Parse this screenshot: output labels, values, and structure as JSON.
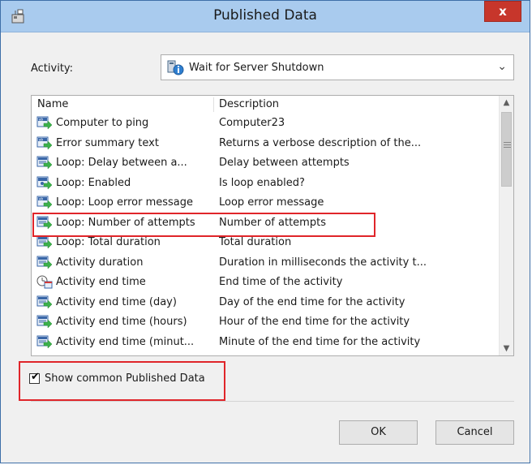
{
  "window": {
    "title": "Published Data",
    "close_label": "x"
  },
  "activity": {
    "label": "Activity:",
    "selected": "Wait for Server Shutdown"
  },
  "list": {
    "columns": {
      "name": "Name",
      "description": "Description"
    },
    "rows": [
      {
        "name": "Computer to ping",
        "description": "Computer23",
        "icon": "text-data-icon"
      },
      {
        "name": "Error summary text",
        "description": "Returns a verbose description of the...",
        "icon": "text-data-icon"
      },
      {
        "name": "Loop: Delay between a...",
        "description": "Delay between attempts",
        "icon": "number-data-icon"
      },
      {
        "name": "Loop: Enabled",
        "description": "Is loop enabled?",
        "icon": "boolean-data-icon"
      },
      {
        "name": "Loop: Loop error message",
        "description": "Loop error message",
        "icon": "text-data-icon"
      },
      {
        "name": "Loop: Number of attempts",
        "description": "Number of attempts",
        "icon": "number-data-icon"
      },
      {
        "name": "Loop: Total duration",
        "description": "Total duration",
        "icon": "number-data-icon"
      },
      {
        "name": "Activity duration",
        "description": "Duration in milliseconds the activity t...",
        "icon": "number-data-icon"
      },
      {
        "name": "Activity end time",
        "description": "End time of the activity",
        "icon": "datetime-data-icon"
      },
      {
        "name": "Activity end time (day)",
        "description": "Day of the end time for the activity",
        "icon": "number-data-icon"
      },
      {
        "name": "Activity end time (hours)",
        "description": "Hour of the end time for the activity",
        "icon": "number-data-icon"
      },
      {
        "name": "Activity end time (minut...",
        "description": "Minute of the end time for the activity",
        "icon": "number-data-icon"
      }
    ]
  },
  "options": {
    "show_common_label": "Show common Published Data",
    "show_common_checked": true
  },
  "buttons": {
    "ok": "OK",
    "cancel": "Cancel"
  },
  "colors": {
    "title_bar": "#a9cbee",
    "close_button": "#c7362b",
    "highlight": "#e0252a"
  }
}
